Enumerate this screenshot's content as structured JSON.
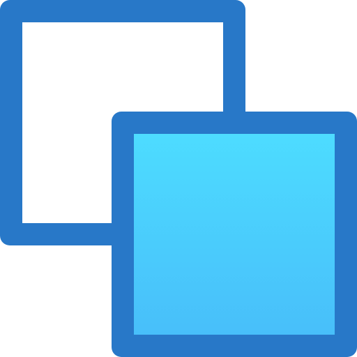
{
  "icon": {
    "name": "bring-to-front-icon",
    "colors": {
      "border": "#2878c8",
      "back_fill": "#ffffff",
      "front_fill_top": "#4ddcff",
      "front_fill_bottom": "#48bffa",
      "background": "#ffffff"
    },
    "shapes": [
      {
        "name": "back-square",
        "role": "outline"
      },
      {
        "name": "front-square",
        "role": "filled"
      }
    ]
  }
}
